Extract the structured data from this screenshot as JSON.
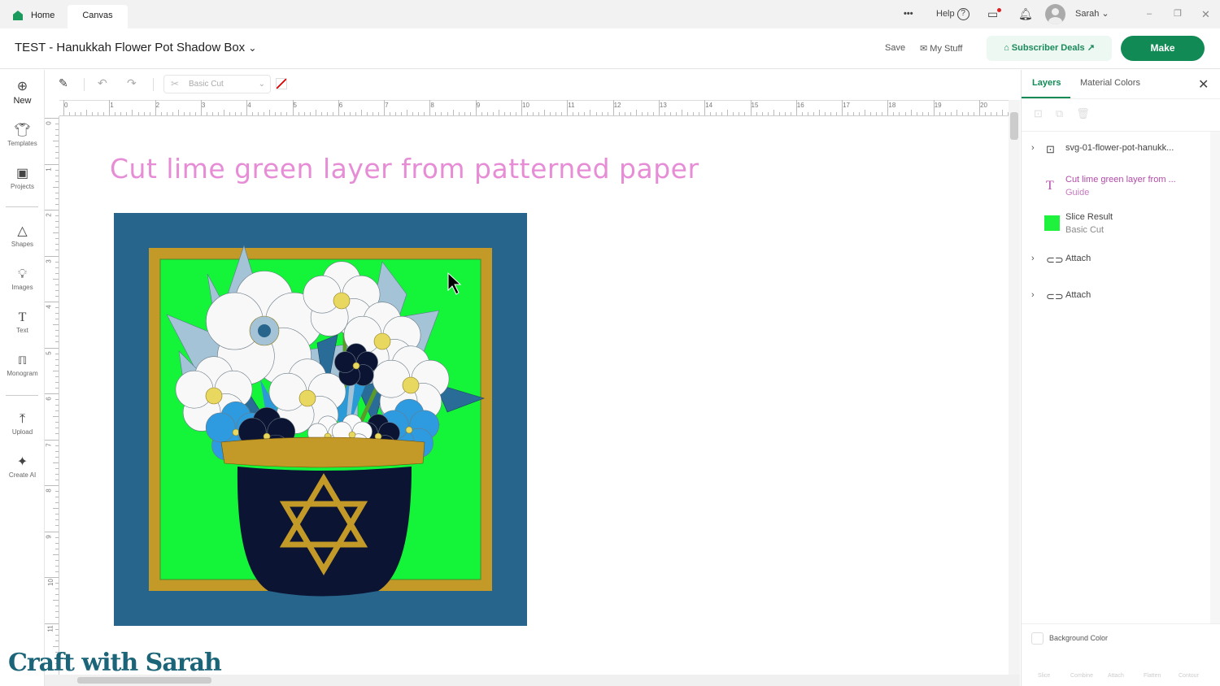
{
  "titlebar": {
    "home": "Home",
    "canvas": "Canvas",
    "more": "•••",
    "help": "Help",
    "user": "Sarah"
  },
  "header": {
    "project_title": "TEST - Hanukkah Flower Pot Shadow Box",
    "save": "Save",
    "my_stuff": "My Stuff",
    "subscriber_deals": "Subscriber Deals",
    "make": "Make"
  },
  "sidebar": {
    "items": [
      {
        "label": "New",
        "icon": "plus-circle-icon"
      },
      {
        "label": "Templates",
        "icon": "shirt-icon"
      },
      {
        "label": "Projects",
        "icon": "projects-icon"
      },
      {
        "label": "Shapes",
        "icon": "shapes-icon"
      },
      {
        "label": "Images",
        "icon": "lightbulb-icon"
      },
      {
        "label": "Text",
        "icon": "text-icon"
      },
      {
        "label": "Monogram",
        "icon": "monogram-icon"
      },
      {
        "label": "Upload",
        "icon": "upload-icon"
      },
      {
        "label": "Create AI",
        "icon": "sparkle-icon"
      }
    ]
  },
  "toolbar": {
    "operation": "Basic Cut"
  },
  "rulers": {
    "horizontal": [
      "0",
      "1",
      "2",
      "3",
      "4",
      "5",
      "6",
      "7",
      "8",
      "9",
      "10",
      "11",
      "12",
      "13",
      "14",
      "15",
      "16",
      "17",
      "18",
      "19",
      "20"
    ],
    "vertical": [
      "0",
      "1",
      "2",
      "3",
      "4",
      "5",
      "6",
      "7",
      "8",
      "9",
      "10",
      "11"
    ]
  },
  "canvas": {
    "guide_text": "Cut lime green layer from patterned paper"
  },
  "panel": {
    "tabs": [
      "Layers",
      "Material Colors"
    ],
    "layers": [
      {
        "name": "svg-01-flower-pot-hanukk...",
        "sub": ""
      },
      {
        "name": "Cut lime green layer from ...",
        "sub": "Guide"
      },
      {
        "name": "Slice Result",
        "sub": "Basic Cut",
        "color": "#1ef23c"
      },
      {
        "name": "Attach",
        "sub": ""
      },
      {
        "name": "Attach",
        "sub": ""
      }
    ],
    "background_color": "Background Color",
    "actions": [
      "Slice",
      "Combine",
      "Attach",
      "Flatten",
      "Contour"
    ]
  },
  "watermark": "Craft with Sarah",
  "colors": {
    "accent": "#128a56",
    "guide": "#e27ad0",
    "bg_blue": "#27658c",
    "gold": "#c39a28",
    "lime": "#14f53a",
    "navy": "#0b1433"
  }
}
